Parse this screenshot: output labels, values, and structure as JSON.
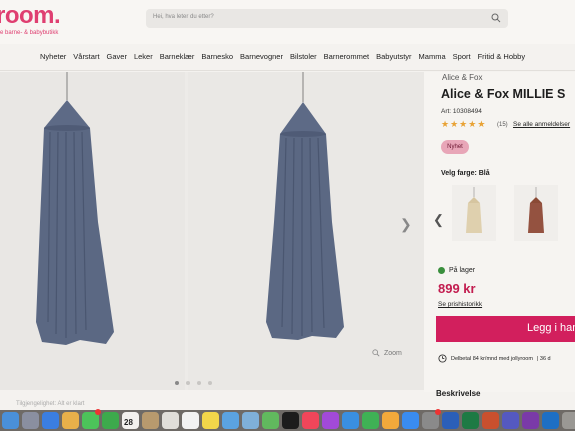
{
  "header": {
    "logo": "room.",
    "tagline": "e barne- & babybutikk",
    "search_placeholder": "Hei, hva leter du etter?"
  },
  "nav": [
    "Nyheter",
    "Vårstart",
    "Gaver",
    "Leker",
    "Barneklær",
    "Barnesko",
    "Barnevogner",
    "Bilstoler",
    "Barnerommet",
    "Babyutstyr",
    "Mamma",
    "Sport",
    "Fritid & Hobby"
  ],
  "gallery": {
    "zoom_label": "Zoom",
    "dot_count": 4,
    "active_dot": 1
  },
  "product": {
    "brand": "Alice & Fox",
    "title": "Alice & Fox MILLIE S",
    "article": "Art: 10308494",
    "rating": 4.5,
    "review_count": "(15)",
    "reviews_link": "Se alle anmeldelser",
    "badge": "Nyhet",
    "color_label": "Velg farge: Blå",
    "stock": "På lager",
    "price": "899 kr",
    "price_history": "Se prishistorikk",
    "buy_label": "Legg i hand",
    "payment_text": "Delbetal 84 kr/mnd med jollyroom",
    "payment_suffix": "| 36 d",
    "description_heading": "Beskrivelse"
  },
  "statusbar": "Tilgjengelighet: Alt er klart",
  "dock": {
    "calendar_day": "28"
  },
  "colors": {
    "brand": "#df3f71",
    "buy_button": "#d21f5d",
    "price": "#c21c4f",
    "stock": "#3a8f3d",
    "canopy": "#5d6a86",
    "stars": "#e8a235"
  }
}
